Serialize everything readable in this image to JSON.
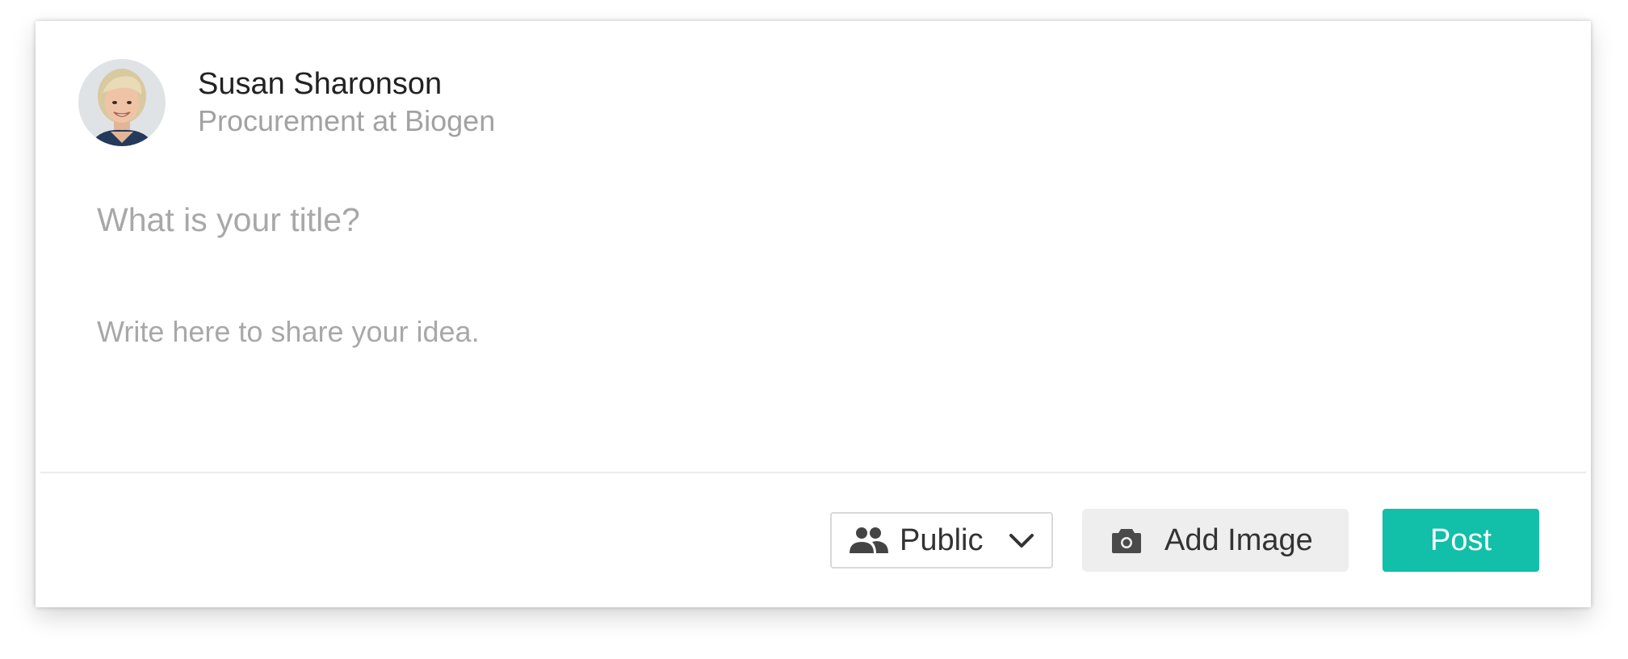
{
  "user": {
    "name": "Susan Sharonson",
    "role": "Procurement at Biogen",
    "avatar_icon": "user-photo-avatar"
  },
  "composer": {
    "title_placeholder": "What is your title?",
    "body_placeholder": "Write here to share your idea.",
    "title_value": "",
    "body_value": ""
  },
  "footer": {
    "privacy": {
      "selected": "Public",
      "icon": "people-icon",
      "chevron_icon": "chevron-down-icon"
    },
    "add_image": {
      "label": "Add Image",
      "icon": "camera-icon"
    },
    "post": {
      "label": "Post"
    }
  },
  "colors": {
    "accent": "#12bfa9",
    "muted_text": "#a8a8a8",
    "button_secondary_bg": "#eeeeee"
  }
}
